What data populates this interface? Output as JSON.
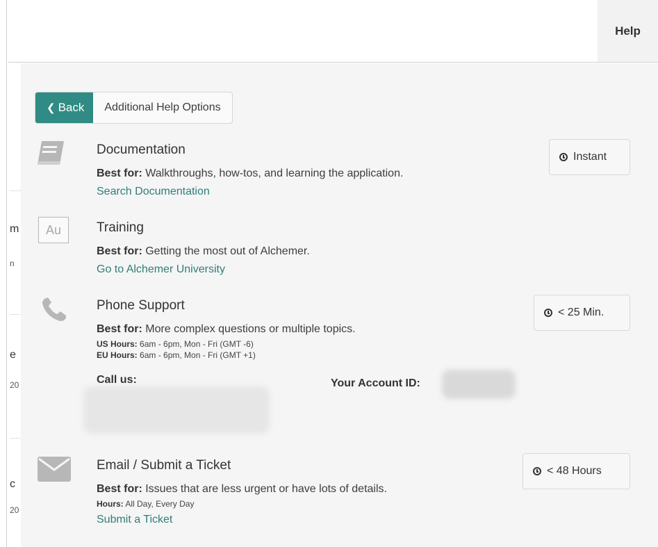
{
  "header": {
    "help_tab": "Help"
  },
  "nav": {
    "back_label": "Back",
    "crumb": "Additional Help Options"
  },
  "background_fragments": [
    "m",
    "n",
    "e",
    "20",
    "c",
    "20"
  ],
  "options": [
    {
      "title": "Documentation",
      "best_for_label": "Best for:",
      "best_for": "Walkthroughs, how-tos, and learning the application.",
      "link": "Search Documentation",
      "time": "Instant",
      "icon": "book-icon"
    },
    {
      "title": "Training",
      "best_for_label": "Best for:",
      "best_for": "Getting the most out of Alchemer.",
      "link": "Go to Alchemer University",
      "icon_text": "Au",
      "icon": "university-icon"
    },
    {
      "title": "Phone Support",
      "best_for_label": "Best for:",
      "best_for": "More complex questions or multiple topics.",
      "us_hours_label": "US Hours:",
      "us_hours": "6am - 6pm, Mon - Fri (GMT -6)",
      "eu_hours_label": "EU Hours:",
      "eu_hours": "6am - 6pm, Mon - Fri (GMT +1)",
      "call_label": "Call us:",
      "account_label": "Your Account ID:",
      "time": "< 25 Min.",
      "icon": "phone-icon"
    },
    {
      "title": "Email / Submit a Ticket",
      "best_for_label": "Best for:",
      "best_for": "Issues that are less urgent or have lots of details.",
      "hours_label": "Hours:",
      "hours": "All Day, Every Day",
      "link": "Submit a Ticket",
      "time": "< 48 Hours",
      "icon": "envelope-icon"
    }
  ],
  "colors": {
    "accent": "#2f8b83",
    "link": "#2f7e78",
    "panel": "#f5f5f5",
    "icon": "#b7b7b7"
  }
}
